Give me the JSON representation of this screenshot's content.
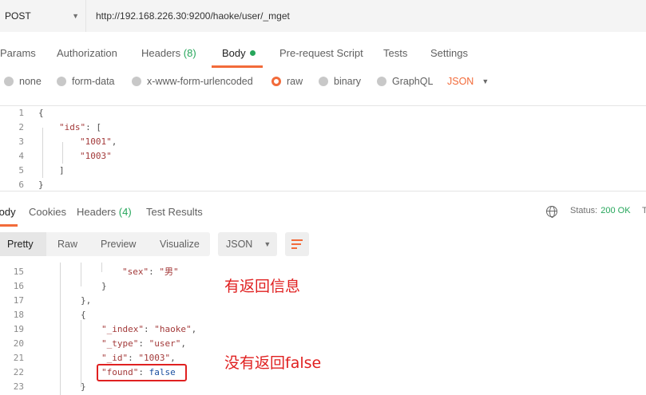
{
  "request": {
    "method": "POST",
    "url": "http://192.168.226.30:9200/haoke/user/_mget"
  },
  "request_tabs": {
    "params": "Params",
    "authorization": "Authorization",
    "headers": "Headers",
    "headers_count": "(8)",
    "body": "Body",
    "pre_request": "Pre-request Script",
    "tests": "Tests",
    "settings": "Settings"
  },
  "body_types": {
    "none": "none",
    "form_data": "form-data",
    "urlencoded": "x-www-form-urlencoded",
    "raw": "raw",
    "binary": "binary",
    "graphql": "GraphQL",
    "format": "JSON",
    "selected": "raw"
  },
  "request_body": {
    "lines": [
      {
        "n": "1",
        "text": "{"
      },
      {
        "n": "2",
        "key": "\"ids\"",
        "rest": ": ["
      },
      {
        "n": "3",
        "str": "\"1001\"",
        "rest": ","
      },
      {
        "n": "4",
        "str": "\"1003\"",
        "rest": ""
      },
      {
        "n": "5",
        "text": "]"
      },
      {
        "n": "6",
        "text": "}"
      }
    ]
  },
  "response_tabs": {
    "body": "Body",
    "cookies": "Cookies",
    "headers": "Headers",
    "headers_count": "(4)",
    "test_results": "Test Results",
    "status_label": "Status:",
    "status_value": "200 OK",
    "status_more": "T"
  },
  "view_controls": {
    "pretty": "Pretty",
    "raw": "Raw",
    "preview": "Preview",
    "visualize": "Visualize",
    "format": "JSON"
  },
  "response_body": {
    "lines": [
      {
        "n": "15",
        "key": "\"sex\"",
        "sep": ": ",
        "str": "\"男\""
      },
      {
        "n": "16",
        "text": "}"
      },
      {
        "n": "17",
        "text": "},"
      },
      {
        "n": "18",
        "text": "{"
      },
      {
        "n": "19",
        "key": "\"_index\"",
        "sep": ": ",
        "str": "\"haoke\"",
        "rest": ","
      },
      {
        "n": "20",
        "key": "\"_type\"",
        "sep": ": ",
        "str": "\"user\"",
        "rest": ","
      },
      {
        "n": "21",
        "key": "\"_id\"",
        "sep": ": ",
        "str": "\"1003\"",
        "rest": ","
      },
      {
        "n": "22",
        "key": "\"found\"",
        "sep": ": ",
        "kw": "false"
      },
      {
        "n": "23",
        "text": "}"
      }
    ]
  },
  "annotations": {
    "note_has_info": "有返回信息",
    "note_no_info": "没有返回false"
  },
  "colors": {
    "accent": "#f26b3a",
    "success": "#26a65b",
    "annotation": "#e02020"
  }
}
